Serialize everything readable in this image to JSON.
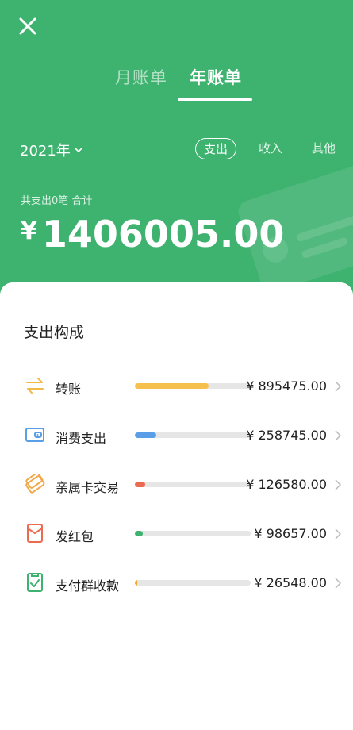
{
  "header": {
    "tabs": [
      {
        "label": "月账单",
        "active": false
      },
      {
        "label": "年账单",
        "active": true
      }
    ],
    "year": "2021年",
    "filters": [
      {
        "label": "支出",
        "active": true
      },
      {
        "label": "收入",
        "active": false
      },
      {
        "label": "其他",
        "active": false
      }
    ],
    "summary_label": "共支出0笔 合计",
    "currency_symbol": "¥",
    "total": "1406005.00"
  },
  "breakdown": {
    "title": "支出构成",
    "rows": [
      {
        "label": "转账",
        "amount": "¥ 895475.00",
        "fraction": 0.637,
        "color": "#f5c04d",
        "icon": "transfer-icon"
      },
      {
        "label": "消费支出",
        "amount": "¥ 258745.00",
        "fraction": 0.184,
        "color": "#5b9ee8",
        "icon": "wallet-icon"
      },
      {
        "label": "亲属卡交易",
        "amount": "¥ 126580.00",
        "fraction": 0.09,
        "color": "#ec6a4f",
        "icon": "family-card-icon"
      },
      {
        "label": "发红包",
        "amount": "¥ 98657.00",
        "fraction": 0.07,
        "color": "#3eb26f",
        "icon": "red-packet-icon"
      },
      {
        "label": "支付群收款",
        "amount": "¥ 26548.00",
        "fraction": 0.019,
        "color": "#f5a623",
        "icon": "group-payment-icon"
      }
    ]
  },
  "colors": {
    "brand": "#3eb26f"
  }
}
